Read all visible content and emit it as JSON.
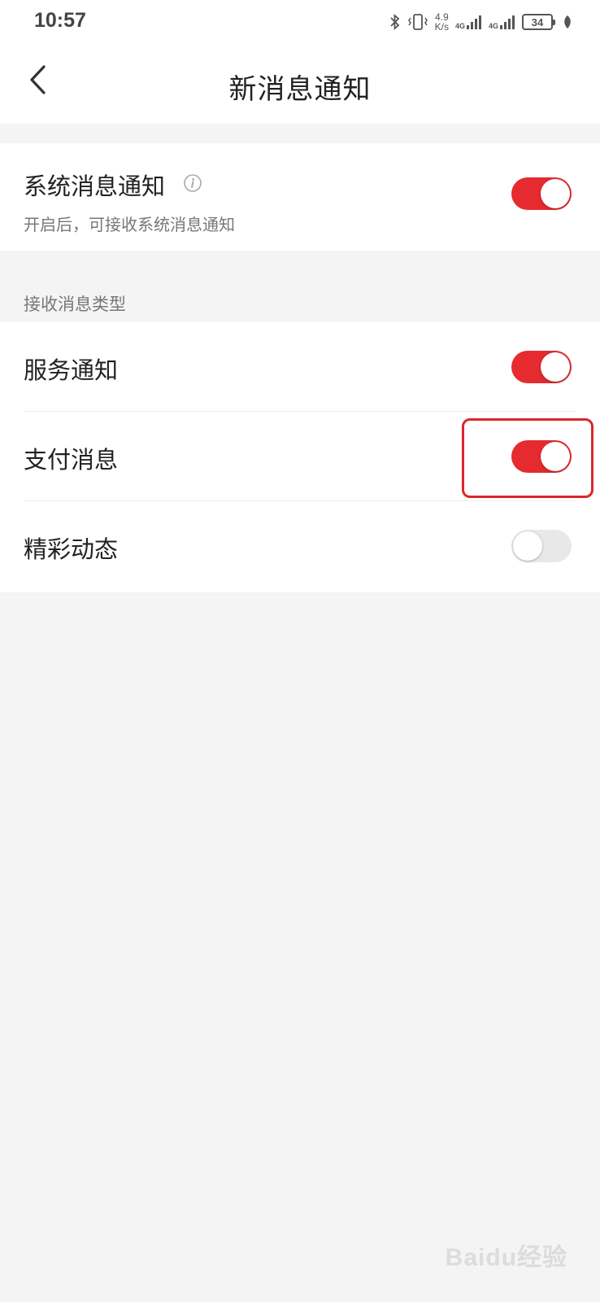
{
  "status_bar": {
    "time": "10:57",
    "speed_value": "4.9",
    "speed_unit": "K/s",
    "network_1": "4G",
    "network_2": "4G",
    "battery": "34",
    "icons": [
      "bluetooth-icon",
      "vibrate-icon",
      "signal-icon",
      "signal-icon",
      "battery-icon",
      "leaf-icon"
    ]
  },
  "header": {
    "title": "新消息通知",
    "back_icon": "chevron-left-icon"
  },
  "system_notification": {
    "title": "系统消息通知",
    "description": "开启后，可接收系统消息通知",
    "enabled": true
  },
  "message_types": {
    "section_label": "接收消息类型",
    "items": [
      {
        "label": "服务通知",
        "enabled": true
      },
      {
        "label": "支付消息",
        "enabled": true
      },
      {
        "label": "精彩动态",
        "enabled": false
      }
    ]
  },
  "watermark": "Baidu经验",
  "colors": {
    "accent": "#e52b2f",
    "highlight": "#d9272e",
    "background": "#f4f4f4",
    "switch_off": "#e8e8e8"
  }
}
